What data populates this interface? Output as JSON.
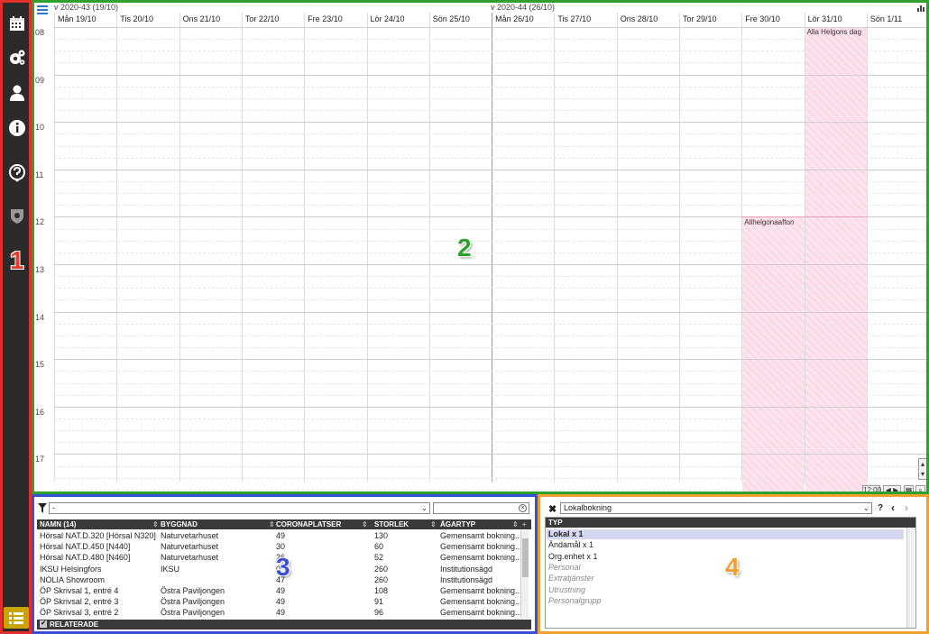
{
  "sidebar": {
    "icons": [
      "calendar-icon",
      "gears-icon",
      "user-icon",
      "info-icon",
      "help-icon",
      "shield-icon",
      "list-icon"
    ],
    "marker": "1"
  },
  "calendar": {
    "marker": "2",
    "weeks": [
      "v 2020-43 (19/10)",
      "v 2020-44 (26/10)"
    ],
    "days": [
      "Mån 19/10",
      "Tis 20/10",
      "Ons 21/10",
      "Tor 22/10",
      "Fre 23/10",
      "Lör 24/10",
      "Sön 25/10",
      "Mån 26/10",
      "Tis 27/10",
      "Ons 28/10",
      "Tor 29/10",
      "Fre 30/10",
      "Lör 31/10",
      "Sön 1/11"
    ],
    "hours": [
      "08",
      "09",
      "10",
      "11",
      "12",
      "13",
      "14",
      "15",
      "16",
      "17"
    ],
    "events": [
      {
        "label": "Alla Helgons dag"
      },
      {
        "label": "Allhelgonaafton"
      }
    ],
    "controls": {
      "time": "12:00"
    }
  },
  "list": {
    "marker": "3",
    "filter_value": "-",
    "search_placeholder": "",
    "columns": [
      "NAMN (14)",
      "BYGGNAD",
      "CORONAPLATSER",
      "STORLEK",
      "ÄGARTYP"
    ],
    "rows": [
      [
        "Hörsal NAT.D.320 [Hörsal N320]",
        "Naturvetarhuset",
        "49",
        "130",
        "Gemensamt bokning..."
      ],
      [
        "Hörsal NAT.D.450 [N440]",
        "Naturvetarhuset",
        "30",
        "60",
        "Gemensamt bokning..."
      ],
      [
        "Hörsal NAT.D.480 [N460]",
        "Naturvetarhuset",
        "26",
        "52",
        "Gemensamt bokning..."
      ],
      [
        "IKSU Helsingfors",
        "IKSU",
        "0",
        "260",
        "Institutionsägd"
      ],
      [
        "NOLIA Showroom",
        "",
        "47",
        "260",
        "Institutionsägd"
      ],
      [
        "ÖP Skrivsal 1, entré 4",
        "Östra Paviljongen",
        "49",
        "108",
        "Gemensamt bokning..."
      ],
      [
        "ÖP Skrivsal 2, entré 3",
        "Östra Paviljongen",
        "49",
        "91",
        "Gemensamt bokning..."
      ],
      [
        "ÖP Skrivsal 3, entré 2",
        "Östra Paviljongen",
        "49",
        "96",
        "Gemensamt bokning..."
      ]
    ],
    "footer": "RELATERADE"
  },
  "detail": {
    "marker": "4",
    "select_value": "Lokalbokning",
    "header": "TYP",
    "items": [
      {
        "label": "Lokal x 1",
        "style": "selected"
      },
      {
        "label": "Ändamål x 1",
        "style": "normal"
      },
      {
        "label": "Org.enhet x 1",
        "style": "normal"
      },
      {
        "label": "Personal",
        "style": "muted"
      },
      {
        "label": "Extratjänster",
        "style": "muted"
      },
      {
        "label": "Utrustning",
        "style": "muted"
      },
      {
        "label": "Personalgrupp",
        "style": "muted"
      }
    ]
  }
}
